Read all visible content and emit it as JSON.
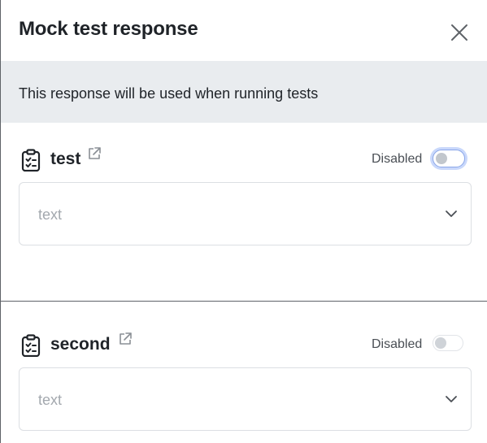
{
  "dialog": {
    "title": "Mock test response",
    "close_icon": "close-icon"
  },
  "banner": {
    "text": "This response will be used when running tests"
  },
  "fields": [
    {
      "name": "test",
      "icon": "clipboard-checklist-icon",
      "link_icon": "external-link-icon",
      "status_label": "Disabled",
      "enabled": false,
      "focused": true,
      "select_value": "text"
    },
    {
      "name": "second",
      "icon": "clipboard-checklist-icon",
      "link_icon": "external-link-icon",
      "status_label": "Disabled",
      "enabled": false,
      "focused": false,
      "select_value": "text"
    }
  ]
}
